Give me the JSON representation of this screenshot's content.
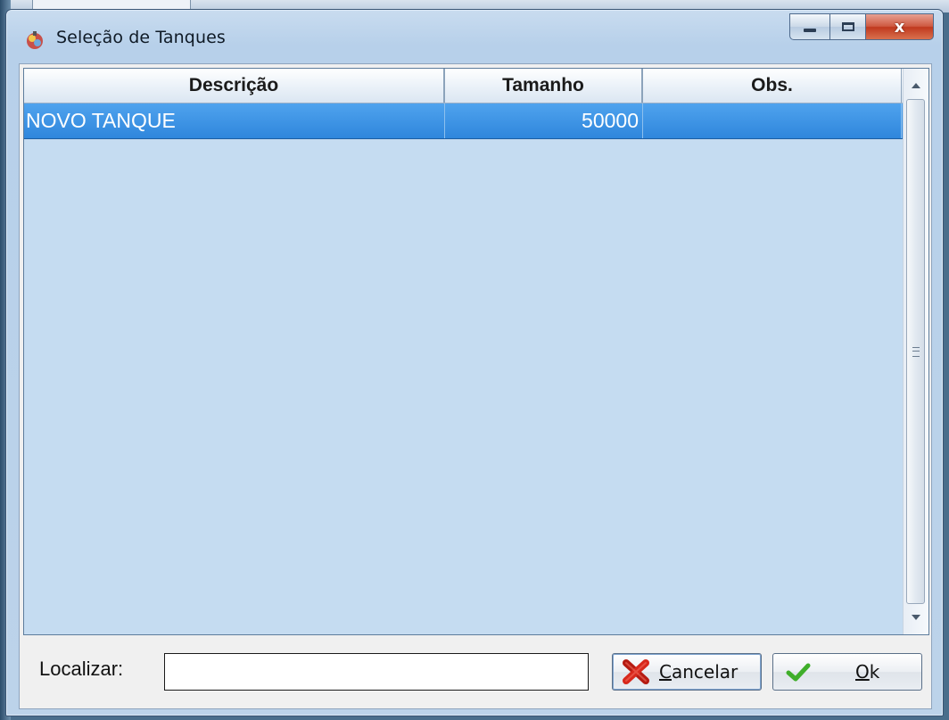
{
  "window": {
    "title": "Seleção de Tanques",
    "close_glyph": "x"
  },
  "grid": {
    "columns": [
      "Descrição",
      "Tamanho",
      "Obs."
    ],
    "rows": [
      {
        "descricao": "NOVO TANQUE",
        "tamanho": "50000",
        "obs": ""
      }
    ],
    "selected_row_index": 0,
    "colors": {
      "selected_row": "#3a90e4",
      "grid_bg": "#c5dcf1"
    }
  },
  "search": {
    "label": "Localizar:",
    "value": ""
  },
  "buttons": {
    "cancel": {
      "accel": "C",
      "rest": "ancelar",
      "icon": "red-x-icon"
    },
    "ok": {
      "accel": "O",
      "rest": "k",
      "icon": "green-check-icon"
    }
  },
  "scroll_grip_glyph": "≡"
}
